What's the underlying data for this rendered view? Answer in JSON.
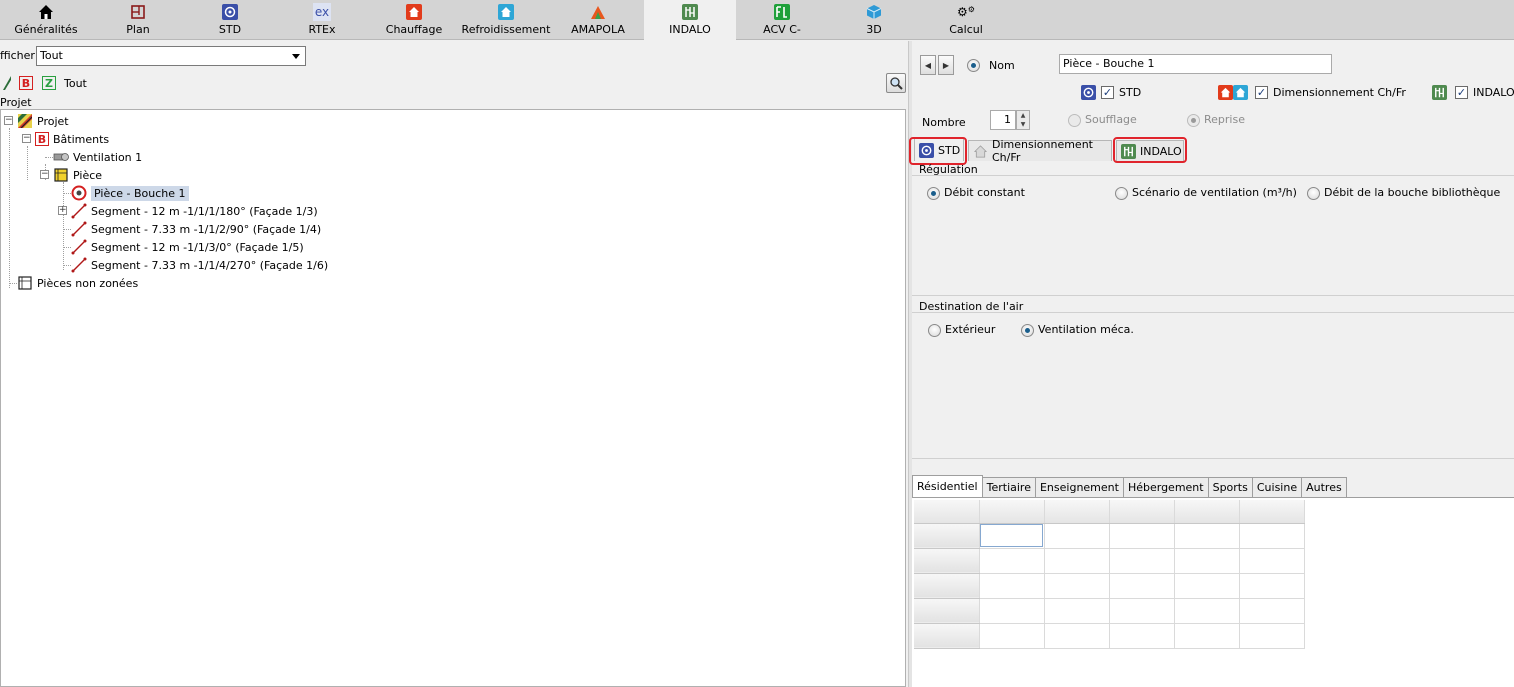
{
  "toolbar": {
    "items": [
      {
        "label": "Généralités",
        "icon": "home-icon"
      },
      {
        "label": "Plan",
        "icon": "plan-icon"
      },
      {
        "label": "STD",
        "icon": "std-icon"
      },
      {
        "label": "RTEx",
        "icon": "rtex-icon",
        "icon_text": "ex"
      },
      {
        "label": "Chauffage",
        "icon": "chauffage-icon"
      },
      {
        "label": "Refroidissement",
        "icon": "refroidissement-icon"
      },
      {
        "label": "AMAPOLA",
        "icon": "amapola-icon"
      },
      {
        "label": "INDALO",
        "icon": "indalo-icon",
        "active": true
      },
      {
        "label": "ACV C-",
        "icon": "acv-icon"
      },
      {
        "label": "3D",
        "icon": "cube-icon"
      },
      {
        "label": "Calcul",
        "icon": "gears-icon"
      }
    ]
  },
  "left": {
    "afficher_label": "fficher",
    "afficher_value": "Tout",
    "filter_label": "Tout",
    "filter_b": "B",
    "filter_z": "Z",
    "projet_header": "Projet",
    "tree": {
      "projet": "Projet",
      "batiments": "Bâtiments",
      "ventilation": "Ventilation 1",
      "piece": "Pièce",
      "piece_bouche": "Pièce - Bouche 1",
      "segment1": "Segment - 12 m -1/1/1/180° (Façade 1/3)",
      "segment2": "Segment - 7.33 m -1/1/2/90° (Façade 1/4)",
      "segment3": "Segment - 12 m -1/1/3/0° (Façade 1/5)",
      "segment4": "Segment - 7.33 m -1/1/4/270° (Façade 1/6)",
      "pieces_non_zonees": "Pièces non zonées"
    }
  },
  "right": {
    "nom_label": "Nom",
    "nom_value": "Pièce - Bouche 1",
    "checks": {
      "std": "STD",
      "dimensionnement": "Dimensionnement Ch/Fr",
      "indalo": "INDALO"
    },
    "nombre_label": "Nombre",
    "nombre_value": "1",
    "soufflage": "Soufflage",
    "reprise": "Reprise",
    "tabs": {
      "std": "STD",
      "dimensionnement": "Dimensionnement Ch/Fr",
      "indalo": "INDALO"
    },
    "regulation": {
      "title": "Régulation",
      "opt1": "Débit constant",
      "opt2": "Scénario de ventilation (m³/h)",
      "opt3": "Débit de la bouche bibliothèque"
    },
    "destination": {
      "title": "Destination de l'air",
      "opt1": "Extérieur",
      "opt2": "Ventilation méca."
    },
    "subtabs": [
      "Résidentiel",
      "Tertiaire",
      "Enseignement",
      "Hébergement",
      "Sports",
      "Cuisine",
      "Autres"
    ]
  },
  "colors": {
    "highlight_red": "#e0242c",
    "selection": "#cdd8e8",
    "radio_dot": "#1a5e8c"
  }
}
